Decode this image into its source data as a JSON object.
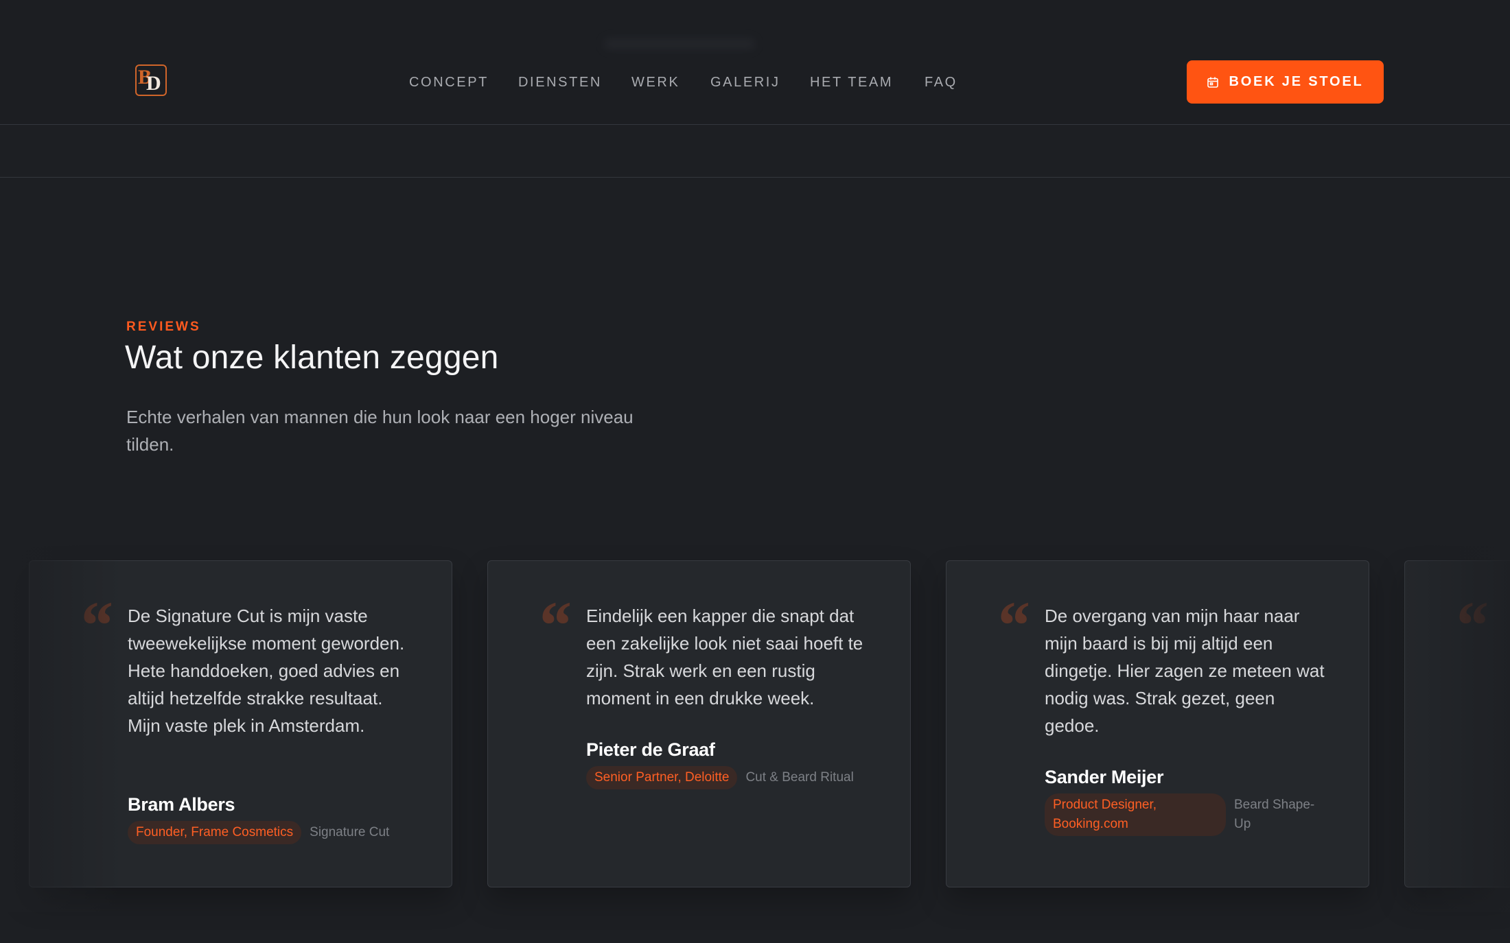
{
  "brand": {
    "logo_letters": [
      "B",
      "D"
    ],
    "accent": "#ff5412"
  },
  "nav": {
    "items": [
      {
        "label": "CONCEPT"
      },
      {
        "label": "DIENSTEN"
      },
      {
        "label": "WERK"
      },
      {
        "label": "GALERIJ"
      },
      {
        "label": "HET TEAM"
      },
      {
        "label": "FAQ"
      }
    ],
    "cta": {
      "label": "BOEK JE STOEL",
      "icon": "calendar-icon"
    }
  },
  "section": {
    "eyebrow": "REVIEWS",
    "title": "Wat onze klanten zeggen",
    "lead": "Echte verhalen van mannen die hun look naar een hoger niveau tilden."
  },
  "reviews": [
    {
      "quote_mark": "“",
      "text": "De Signature Cut is mijn vaste tweewekelijkse moment geworden. Hete handdoeken, goed advies en altijd hetzelfde strakke resultaat. Mijn vaste plek in Amsterdam.",
      "name": "Bram Albers",
      "role": "Founder, Frame Cosmetics",
      "service": "Signature Cut"
    },
    {
      "quote_mark": "“",
      "text": "Eindelijk een kapper die snapt dat een zakelijke look niet saai hoeft te zijn. Strak werk en een rustig moment in een drukke week.",
      "name": "Pieter de Graaf",
      "role": "Senior Partner, Deloitte",
      "service": "Cut & Beard Ritual"
    },
    {
      "quote_mark": "“",
      "text": "De overgang van mijn haar naar mijn baard is bij mij altijd een dingetje. Hier zagen ze meteen wat nodig was. Strak gezet, geen gedoe.",
      "name": "Sander Meijer",
      "role": "Product Designer, Booking.com",
      "service": "Beard Shape-Up"
    },
    {
      "quote_mark": "“"
    }
  ]
}
